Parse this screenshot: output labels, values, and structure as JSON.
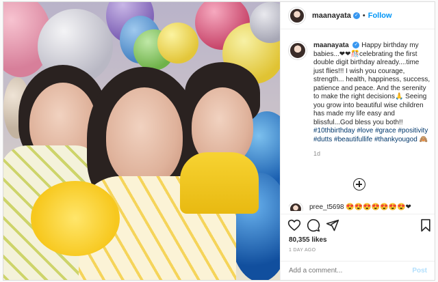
{
  "header": {
    "username": "maanayata",
    "verified_mark": "✓",
    "separator": "•",
    "follow_label": "Follow"
  },
  "caption": {
    "username": "maanayata",
    "verified_mark": "✓",
    "text": "Happy birthday my babies...❤❤🎊celebrating the first double digit birthday already....time just flies!!! I wish you courage, strength... health, happiness, success, patience and peace. And the serenity to make the right decisions🙏 Seeing you grow into beautiful wise children has made my life easy and blissful...God bless you both!!",
    "hashtags": "#10thbirthday #love #grace #positivity #dutts #beautifullife #thankyougod 🙈",
    "age": "1d"
  },
  "comment_peek": {
    "text": "pree_t5698 😍😍😍😍😍😍😍❤"
  },
  "actions": {
    "likes": "80,355 likes",
    "date": "1 DAY AGO"
  },
  "add_comment": {
    "placeholder": "Add a comment...",
    "post_label": "Post"
  },
  "icons": {
    "like": "heart-icon",
    "comment": "comment-icon",
    "share": "share-icon",
    "save": "bookmark-icon",
    "load_more": "plus-circle-icon"
  },
  "colors": {
    "link_blue": "#0095f6",
    "hashtag": "#00376b",
    "muted": "#8e8e8e",
    "post_disabled": "#b2dffc"
  }
}
